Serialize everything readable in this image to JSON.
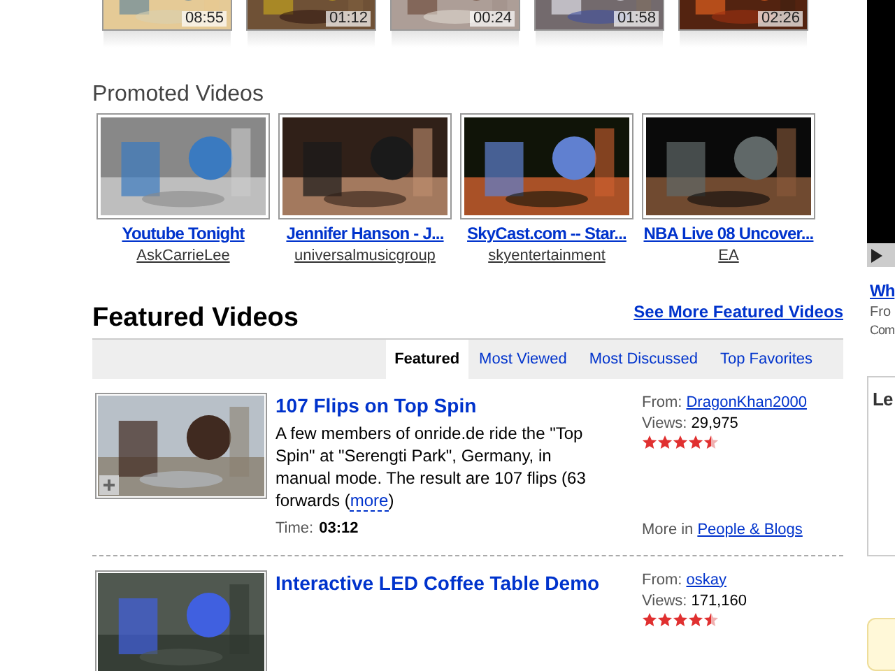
{
  "top_videos": [
    {
      "duration": "08:55"
    },
    {
      "duration": "01:12"
    },
    {
      "duration": "00:24"
    },
    {
      "duration": "01:58"
    },
    {
      "duration": "02:26"
    }
  ],
  "promoted": {
    "title": "Promoted Videos",
    "videos": [
      {
        "title": "Youtube Tonight",
        "channel": "AskCarrieLee"
      },
      {
        "title": "Jennifer Hanson - J...",
        "channel": "universalmusicgroup"
      },
      {
        "title": "SkyCast.com -- Star...",
        "channel": "skyentertainment"
      },
      {
        "title": "NBA Live 08 Uncover...",
        "channel": "EA"
      }
    ]
  },
  "featured": {
    "title": "Featured Videos",
    "see_more": "See More Featured Videos",
    "tabs": [
      {
        "label": "Featured",
        "selected": true
      },
      {
        "label": "Most Viewed",
        "selected": false
      },
      {
        "label": "Most Discussed",
        "selected": false
      },
      {
        "label": "Top Favorites",
        "selected": false
      }
    ],
    "videos": [
      {
        "title": "107 Flips on Top Spin",
        "description": "A few members of onride.de ride the \"Top Spin\" at \"Serengti Park\", Germany, in manual mode. The result are 107 flips (63 forwards",
        "more_open": "(",
        "more": "more",
        "more_close": ")",
        "time_label": "Time:",
        "time": "03:12",
        "from_label": "From:",
        "from": "DragonKhan2000",
        "views_label": "Views:",
        "views": "29,975",
        "stars": 4.5,
        "category_label": "More in",
        "category": "People & Blogs"
      },
      {
        "title": "Interactive LED Coffee Table Demo",
        "from_label": "From:",
        "from": "oskay",
        "views_label": "Views:",
        "views": "171,160",
        "stars": 4.5
      }
    ]
  },
  "side": {
    "link": "Wh",
    "line_1": "Fro",
    "line_2": "Com",
    "box_title": "Le"
  }
}
